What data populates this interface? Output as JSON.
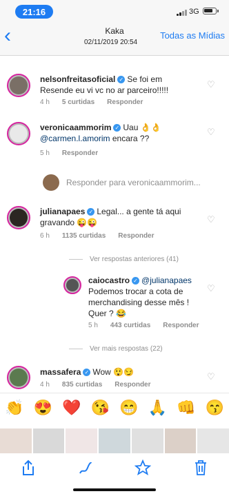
{
  "status_bar": {
    "time": "21:16",
    "network": "3G"
  },
  "header": {
    "back": "‹",
    "title": "Kaka",
    "subtitle": "02/11/2019 20:54",
    "right_link": "Todas as Mídias"
  },
  "comments": [
    {
      "username": "nelsonfreitasoficial",
      "text_line1": "Se foi em",
      "text_line2": "Resende eu vi vc no ar parceiro!!!!!",
      "time": "4 h",
      "likes": "5 curtidas",
      "reply": "Responder"
    },
    {
      "username": "veronicaammorim",
      "text_line1": "Uau 👌👌",
      "text_line2_mention": "@carmen.l.amorim",
      "text_line2_rest": " encara ??",
      "time": "5 h",
      "reply": "Responder"
    },
    {
      "username": "julianapaes",
      "text_line1": "Legal... a gente tá aqui",
      "text_line2": "gravando 😜😜",
      "time": "6 h",
      "likes": "1135 curtidas",
      "reply": "Responder"
    },
    {
      "username": "caiocastro",
      "mention": "@julianapaes",
      "text_line2": "Podemos trocar a cota de",
      "text_line3": "merchandising desse mês !",
      "text_line4": "Quer ? 😂",
      "time": "5 h",
      "likes": "443 curtidas",
      "reply": "Responder"
    },
    {
      "username": "massafera",
      "text_line1": "Wow 😲😏",
      "time": "4 h",
      "likes": "835 curtidas",
      "reply": "Responder"
    }
  ],
  "reply_to": "Responder para veronicaammorim...",
  "view_previous": "Ver respostas anteriores (41)",
  "view_more": "Ver mais respostas (22)",
  "emojis": [
    "👏",
    "😍",
    "❤️",
    "😘",
    "😁",
    "🙏",
    "👊",
    "😙"
  ],
  "toolbar_icons": [
    "share-icon",
    "markup-icon",
    "star-icon",
    "trash-icon"
  ],
  "colors": {
    "accent": "#1e7cf2",
    "verified": "#3897f0",
    "ring": "#d6249f"
  },
  "battery_level": 0.85
}
